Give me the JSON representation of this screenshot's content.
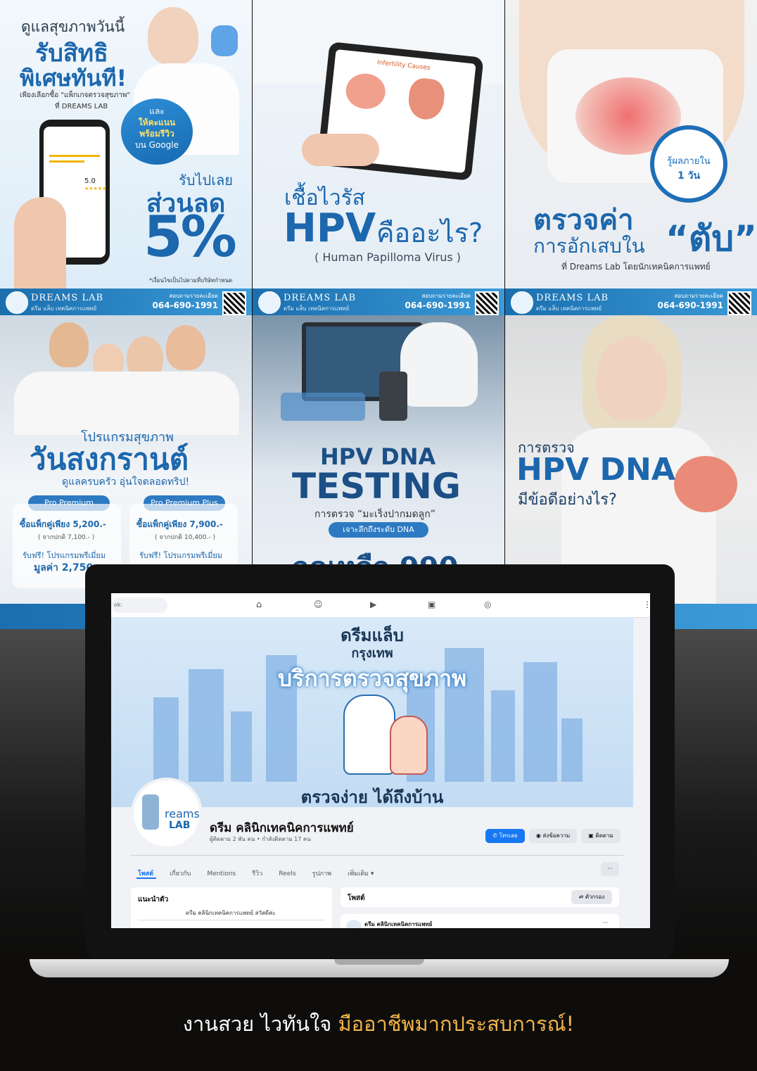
{
  "brand": {
    "name": "DREAMS LAB",
    "sub": "ดรีม แล็บ เทคนิคการแพทย์",
    "phone_label": "สอบถามรายละเอียด",
    "phone": "064-690-1991"
  },
  "tile1": {
    "line1": "ดูแลสุขภาพวันนี้",
    "line2": "รับสิทธิ",
    "line3": "พิเศษทันที!",
    "line4": "เพียงเลือกซื้อ \"แพ็กเกจตรวจสุขภาพ\"",
    "line5": "ที่ DREAMS LAB",
    "bubble1": "และ",
    "bubble2": "ให้คะแนน",
    "bubble3": "พร้อมรีวิว",
    "bubble4": "บน Google",
    "receive": "รับไปเลย",
    "discount": "ส่วนลด",
    "percent": "5%",
    "note": "*เงื่อนไขเป็นไปตามที่บริษัทกำหนด",
    "rating": "5.0"
  },
  "tile2": {
    "tablet_title": "Infertility Causes",
    "line1": "เชื้อไวรัส",
    "big": "HPV",
    "question": "คืออะไร?",
    "sub": "( Human Papilloma Virus )"
  },
  "tile3": {
    "badge1": "รู้ผลภายใน",
    "badge2": "1 วัน",
    "line1": "ตรวจค่า",
    "line2": "การอักเสบใน",
    "line3": "“ตับ”",
    "line4": "ที่ Dreams Lab โดยนักเทคนิคการแพทย์"
  },
  "tile4": {
    "line1": "โปรแกรมสุขภาพ",
    "line2": "วันสงกรานต์",
    "line3": "ดูแลครบครัว อุ่นใจตลอดทริป!",
    "pkg1": "Pro Premium",
    "pkg2": "Pro Premium Plus",
    "price1": "ซื้อแพ็กคู่เพียง 5,200.-",
    "price2": "ซื้อแพ็กคู่เพียง 7,900.-",
    "orig1": "( จากปกติ 7,100.- )",
    "orig2": "( จากปกติ 10,400.- )",
    "free": "รับฟรี! โปรแกรมพรีเมี่ยม",
    "value1": "มูลค่า 2,750"
  },
  "tile5": {
    "line1": "HPV DNA",
    "line2": "TESTING",
    "line3": "การตรวจ “มะเร็งปากมดลูก”",
    "pill": "เจาะลึกถึงระดับ DNA",
    "line4": "ลดเหลือ 990"
  },
  "tile6": {
    "line1": "การตรวจ",
    "line2": "HPV DNA",
    "line3": "มีข้อดีอย่างไร?"
  },
  "facebook": {
    "search": "ok:",
    "cover_line1": "ดรีมแล็บ",
    "cover_line2": "กรุงเทพ",
    "cover_line3": "บริการตรวจสุขภาพ",
    "cover_line4": "ตรวจง่าย ได้ถึงบ้าน",
    "logo_text1": "reams",
    "logo_text2": "LAB",
    "page_name": "ดรีม คลินิกเทคนิคการแพทย์",
    "followers": "ผู้ติดตาม 2 พัน คน • กำลังติดตาม 17 คน",
    "btn_call": "โทรเลย",
    "btn_msg": "ส่งข้อความ",
    "btn_follow": "ติดตาม",
    "tabs": [
      "โพสต์",
      "เกี่ยวกับ",
      "Mentions",
      "รีวิว",
      "Reels",
      "รูปภาพ",
      "เพิ่มเติม ▾"
    ],
    "more": "···",
    "intro_title": "แนะนำตัว",
    "intro_text": "ดรีม คลินิกเทคนิคการแพทย์ สวัสดีค่ะ",
    "posts_title": "โพสต์",
    "filter": "ตัวกรอง",
    "post_author": "ดรีม คลินิกเทคนิคการแพทย์"
  },
  "tagline": {
    "white": "งานสวย ไวทันใจ ",
    "gold": "มืออาชีพมากประสบการณ์!"
  },
  "colors": {
    "brand_blue": "#1c67ad",
    "gold": "#f2b54a",
    "fb_blue": "#1877f2"
  }
}
